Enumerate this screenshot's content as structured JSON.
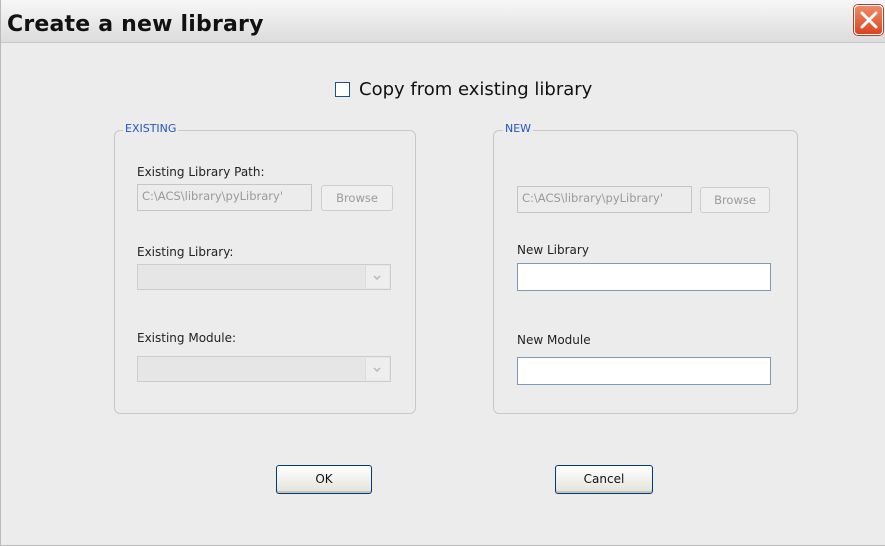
{
  "window": {
    "title": "Create a new library"
  },
  "copy_option": {
    "label": "Copy from existing library",
    "checked": false
  },
  "existing": {
    "legend": "EXISTING",
    "path_label": "Existing Library Path:",
    "path_value": "C:\\ACS\\library\\pyLibrary'",
    "browse_label": "Browse",
    "library_label": "Existing Library:",
    "library_value": "",
    "module_label": "Existing Module:",
    "module_value": ""
  },
  "new": {
    "legend": "NEW",
    "path_value": "C:\\ACS\\library\\pyLibrary'",
    "browse_label": "Browse",
    "library_label": "New Library",
    "library_value": "",
    "module_label": "New Module",
    "module_value": ""
  },
  "buttons": {
    "ok": "OK",
    "cancel": "Cancel"
  },
  "colors": {
    "legend": "#2255cc",
    "close_button": "#d9451f",
    "window_bg": "#ececec"
  },
  "icons": {
    "close": "close-x-icon",
    "dropdown": "chevron-down-icon"
  }
}
